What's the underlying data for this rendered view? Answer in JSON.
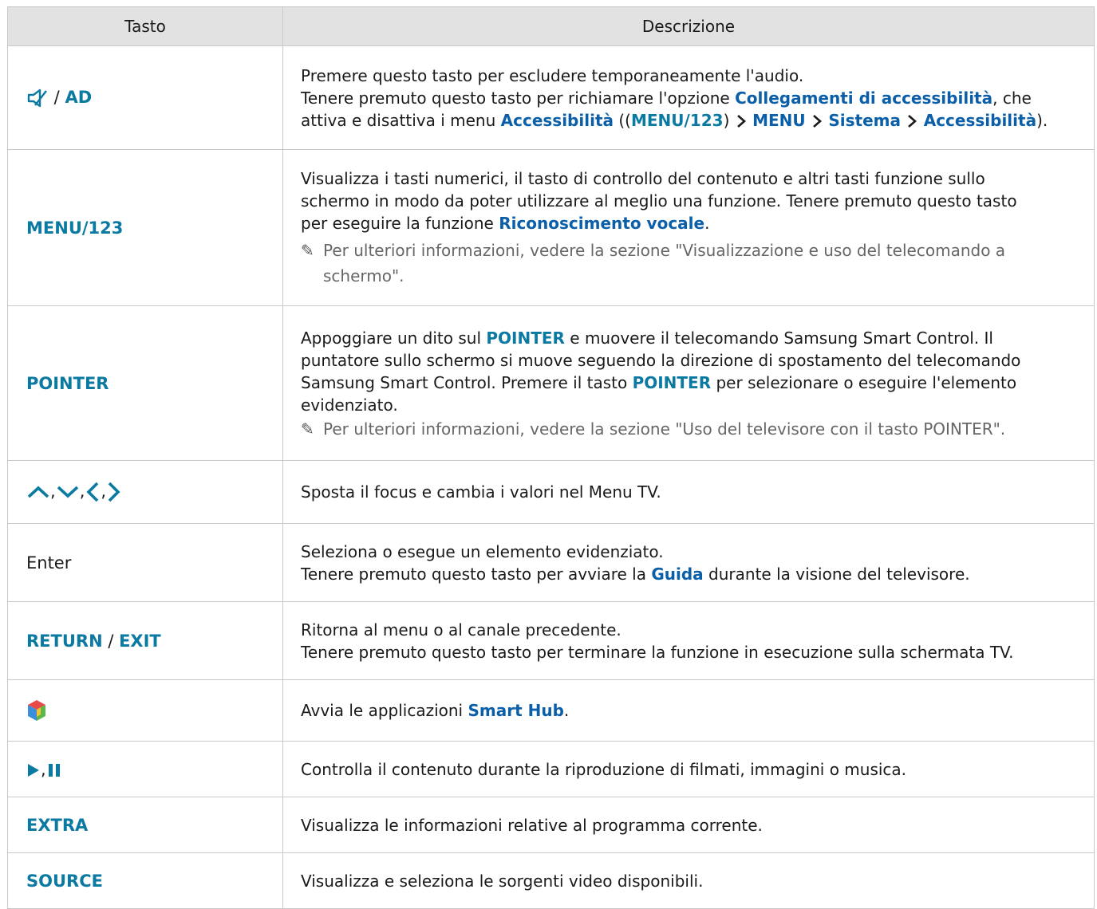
{
  "header": {
    "col_key": "Tasto",
    "col_desc": "Descrizione"
  },
  "rows": {
    "r0": {
      "key_sep": " / ",
      "key_b": "AD",
      "l1": "Premere questo tasto per escludere temporaneamente l'audio.",
      "l2a": "Tenere premuto questo tasto per richiamare l'opzione ",
      "l2b": "Collegamenti di accessibilità",
      "l2c": ", che",
      "l3a": "attiva e disattiva i menu ",
      "l3b": "Accessibilità",
      "l3c": " ((",
      "l3d": "MENU/123",
      "l3e": ") ",
      "l3f": "MENU",
      "l3g": "Sistema",
      "l3h": "Accessibilità",
      "l3i": ")."
    },
    "r1": {
      "key": "MENU/123",
      "l1": "Visualizza i tasti numerici, il tasto di controllo del contenuto e altri tasti funzione sullo",
      "l2": "schermo in modo da poter utilizzare al meglio una funzione. Tenere premuto questo tasto",
      "l3a": "per eseguire la funzione ",
      "l3b": "Riconoscimento vocale",
      "l3c": ".",
      "note": "Per ulteriori informazioni, vedere la sezione \"Visualizzazione e uso del telecomando a schermo\"."
    },
    "r2": {
      "key": "POINTER",
      "l1a": "Appoggiare un dito sul ",
      "l1b": "POINTER",
      "l1c": " e muovere il telecomando Samsung Smart Control. Il",
      "l2": "puntatore sullo schermo si muove seguendo la direzione di spostamento del telecomando",
      "l3a": "Samsung Smart Control. Premere il tasto ",
      "l3b": "POINTER",
      "l3c": " per selezionare o eseguire l'elemento",
      "l4": "evidenziato.",
      "note": "Per ulteriori informazioni, vedere la sezione \"Uso del televisore con il tasto POINTER\"."
    },
    "r3": {
      "key_commas": ",",
      "desc": "Sposta il focus e cambia i valori nel Menu TV."
    },
    "r4": {
      "key": "Enter",
      "l1": "Seleziona o esegue un elemento evidenziato.",
      "l2a": "Tenere premuto questo tasto per avviare la ",
      "l2b": "Guida",
      "l2c": " durante la visione del televisore."
    },
    "r5": {
      "key_a": "RETURN",
      "key_sep": " / ",
      "key_b": "EXIT",
      "l1": "Ritorna al menu o al canale precedente.",
      "l2": "Tenere premuto questo tasto per terminare la funzione in esecuzione sulla schermata TV."
    },
    "r6": {
      "l1a": "Avvia le applicazioni ",
      "l1b": "Smart Hub",
      "l1c": "."
    },
    "r7": {
      "key_comma": ",",
      "desc": "Controlla il contenuto durante la riproduzione di filmati, immagini o musica."
    },
    "r8": {
      "key": "EXTRA",
      "desc": "Visualizza le informazioni relative al programma corrente."
    },
    "r9": {
      "key": "SOURCE",
      "desc": "Visualizza e seleziona le sorgenti video disponibili."
    }
  },
  "colors": {
    "accent_key": "#0b7aa3",
    "accent_link": "#0a5fa8",
    "header_bg": "#e2e2e2",
    "border": "#c9c9c9"
  }
}
